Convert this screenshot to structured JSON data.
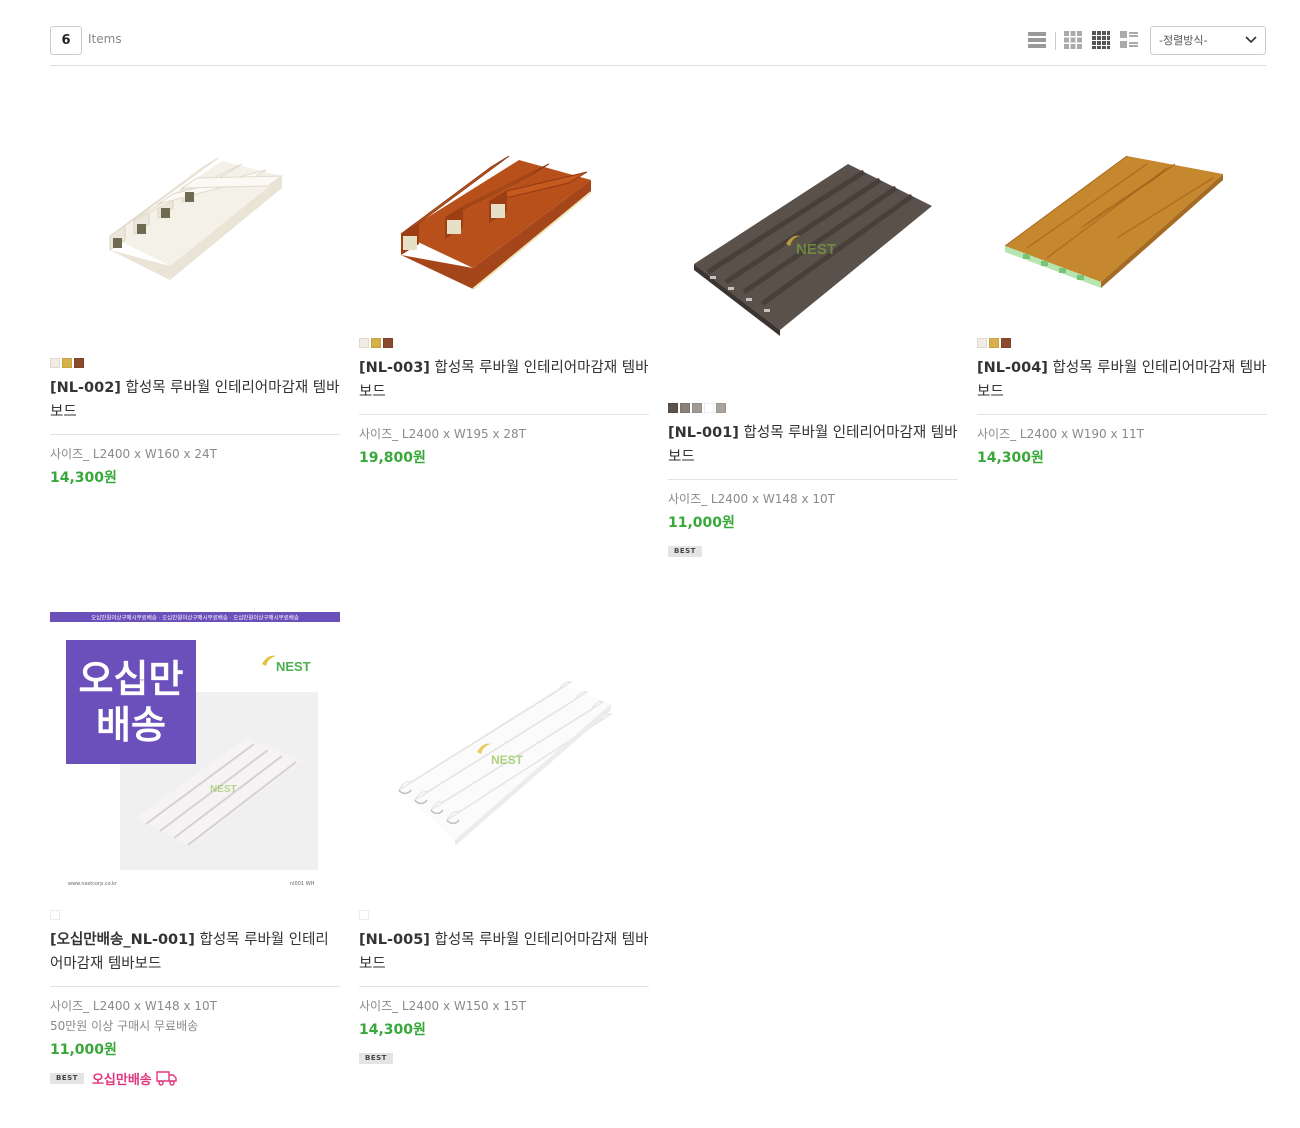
{
  "toolbar": {
    "item_count": "6",
    "item_count_label": "Items",
    "sort_label": "-정렬방식-",
    "view_icons": [
      "list-view-icon",
      "grid-3-icon",
      "grid-4-icon",
      "list-detail-icon"
    ]
  },
  "colors": {
    "price": "#38a83a",
    "shipping_badge": "#e0367e",
    "promo_purple": "#6b4fbb"
  },
  "products": [
    {
      "swatches": [
        "#f1ede4",
        "#d8b04a",
        "#8a4a2b"
      ],
      "code": "[NL-002]",
      "name": " 합성목 루바월 인테리어마감재 템바보드",
      "spec": "사이즈_ L2400 x W160 x 24T",
      "price": "14,300원"
    },
    {
      "swatches": [
        "#f1ede4",
        "#d8b04a",
        "#8a4a2b"
      ],
      "code": "[NL-003]",
      "name": " 합성목 루바월 인테리어마감재 템바보드",
      "spec": "사이즈_ L2400 x W195 x 28T",
      "price": "19,800원"
    },
    {
      "swatches": [
        "#5e534c",
        "#8c7f77",
        "#a09a92",
        "#ffffff",
        "#aaa39c"
      ],
      "code": "[NL-001]",
      "name": " 합성목 루바월 인테리어마감재 템바보드",
      "spec": "사이즈_ L2400 x W148 x 10T",
      "price": "11,000원",
      "badge": "BEST"
    },
    {
      "swatches": [
        "#f1ede4",
        "#d8b04a",
        "#8a4a2b"
      ],
      "code": "[NL-004]",
      "name": " 합성목 루바월 인테리어마감재 템바보드",
      "spec": "사이즈_ L2400 x W190 x 11T",
      "price": "14,300원"
    },
    {
      "swatches": [
        "#ffffff"
      ],
      "code": "[오십만배송_NL-001]",
      "name": " 합성목 루바월 인테리어마감재 템바보드",
      "spec": "사이즈_ L2400 x W148 x 10T",
      "note": "50만원 이상 구매시 무료배송",
      "price": "11,000원",
      "badge": "BEST",
      "shipping_label": "오십만배송",
      "promo": {
        "banner": "오십만원이상구매시무료배송 · 오십만원이상구매시무료배송 · 오십만원이상구매시무료배송",
        "line1": "오십만",
        "line2": "배송",
        "brand": "NEST",
        "website": "www.nestcorp.co.kr",
        "model": "nl001 WH"
      }
    },
    {
      "swatches": [
        "#ffffff"
      ],
      "code": "[NL-005]",
      "name": " 합성목 루바월 인테리어마감재 템바보드",
      "spec": "사이즈_ L2400 x W150 x 15T",
      "price": "14,300원",
      "badge": "BEST"
    }
  ],
  "watermark": "NEST"
}
